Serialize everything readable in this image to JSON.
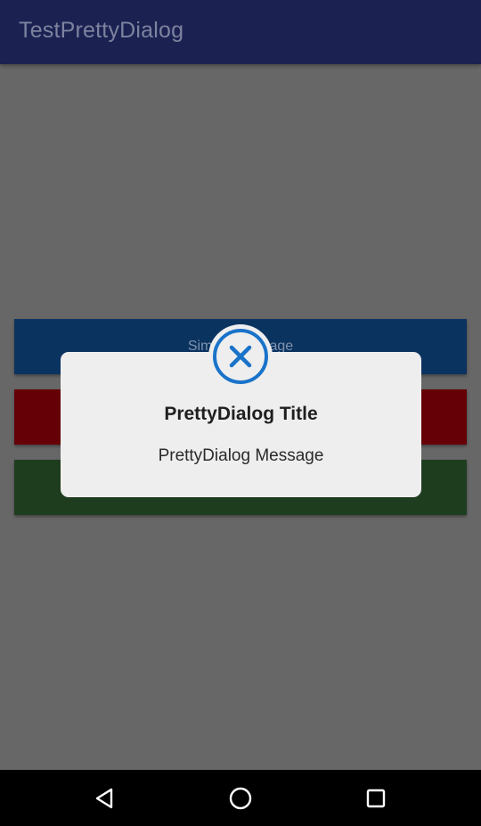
{
  "app_bar": {
    "title": "TestPrettyDialog"
  },
  "buttons": [
    {
      "label": "Simple Message",
      "color": "#0b3360"
    },
    {
      "label": "",
      "color": "#650106"
    },
    {
      "label": "",
      "color": "#1e3d1f"
    }
  ],
  "dialog": {
    "icon": "close-circle-icon",
    "icon_color": "#1a73c9",
    "title": "PrettyDialog Title",
    "message": "PrettyDialog Message"
  },
  "nav_bar": {
    "back": "back-icon",
    "home": "home-icon",
    "recents": "recents-icon"
  },
  "colors": {
    "app_bar": "#1b2252",
    "scrim_background": "#676767",
    "dialog_background": "#eeeeee"
  }
}
